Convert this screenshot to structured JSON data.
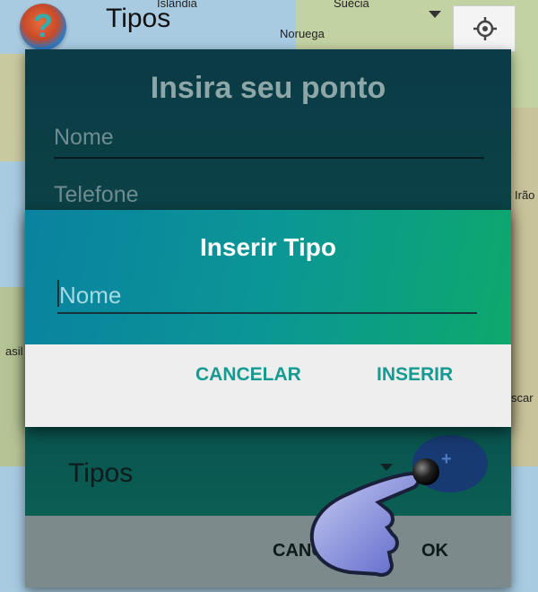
{
  "map": {
    "labels": [
      "Islândia",
      "Suécia",
      "Noruega",
      "Irão",
      "asil",
      "scar"
    ]
  },
  "topbar": {
    "title": "Tipos",
    "logo_icon": "question-mark-logo",
    "locate_icon": "crosshair-icon"
  },
  "back_dialog": {
    "title": "Insira seu ponto",
    "name_placeholder": "Nome",
    "phone_placeholder": "Telefone",
    "tipos_label": "Tipos",
    "cancel_label": "CANCELAR",
    "ok_label": "OK"
  },
  "front_dialog": {
    "title": "Inserir Tipo",
    "name_placeholder": "Nome",
    "cancel_label": "CANCELAR",
    "insert_label": "INSERIR"
  },
  "colors": {
    "accent": "#169a92",
    "dialog_gradient_start": "#0a82a0",
    "dialog_gradient_end": "#0ea86c"
  }
}
